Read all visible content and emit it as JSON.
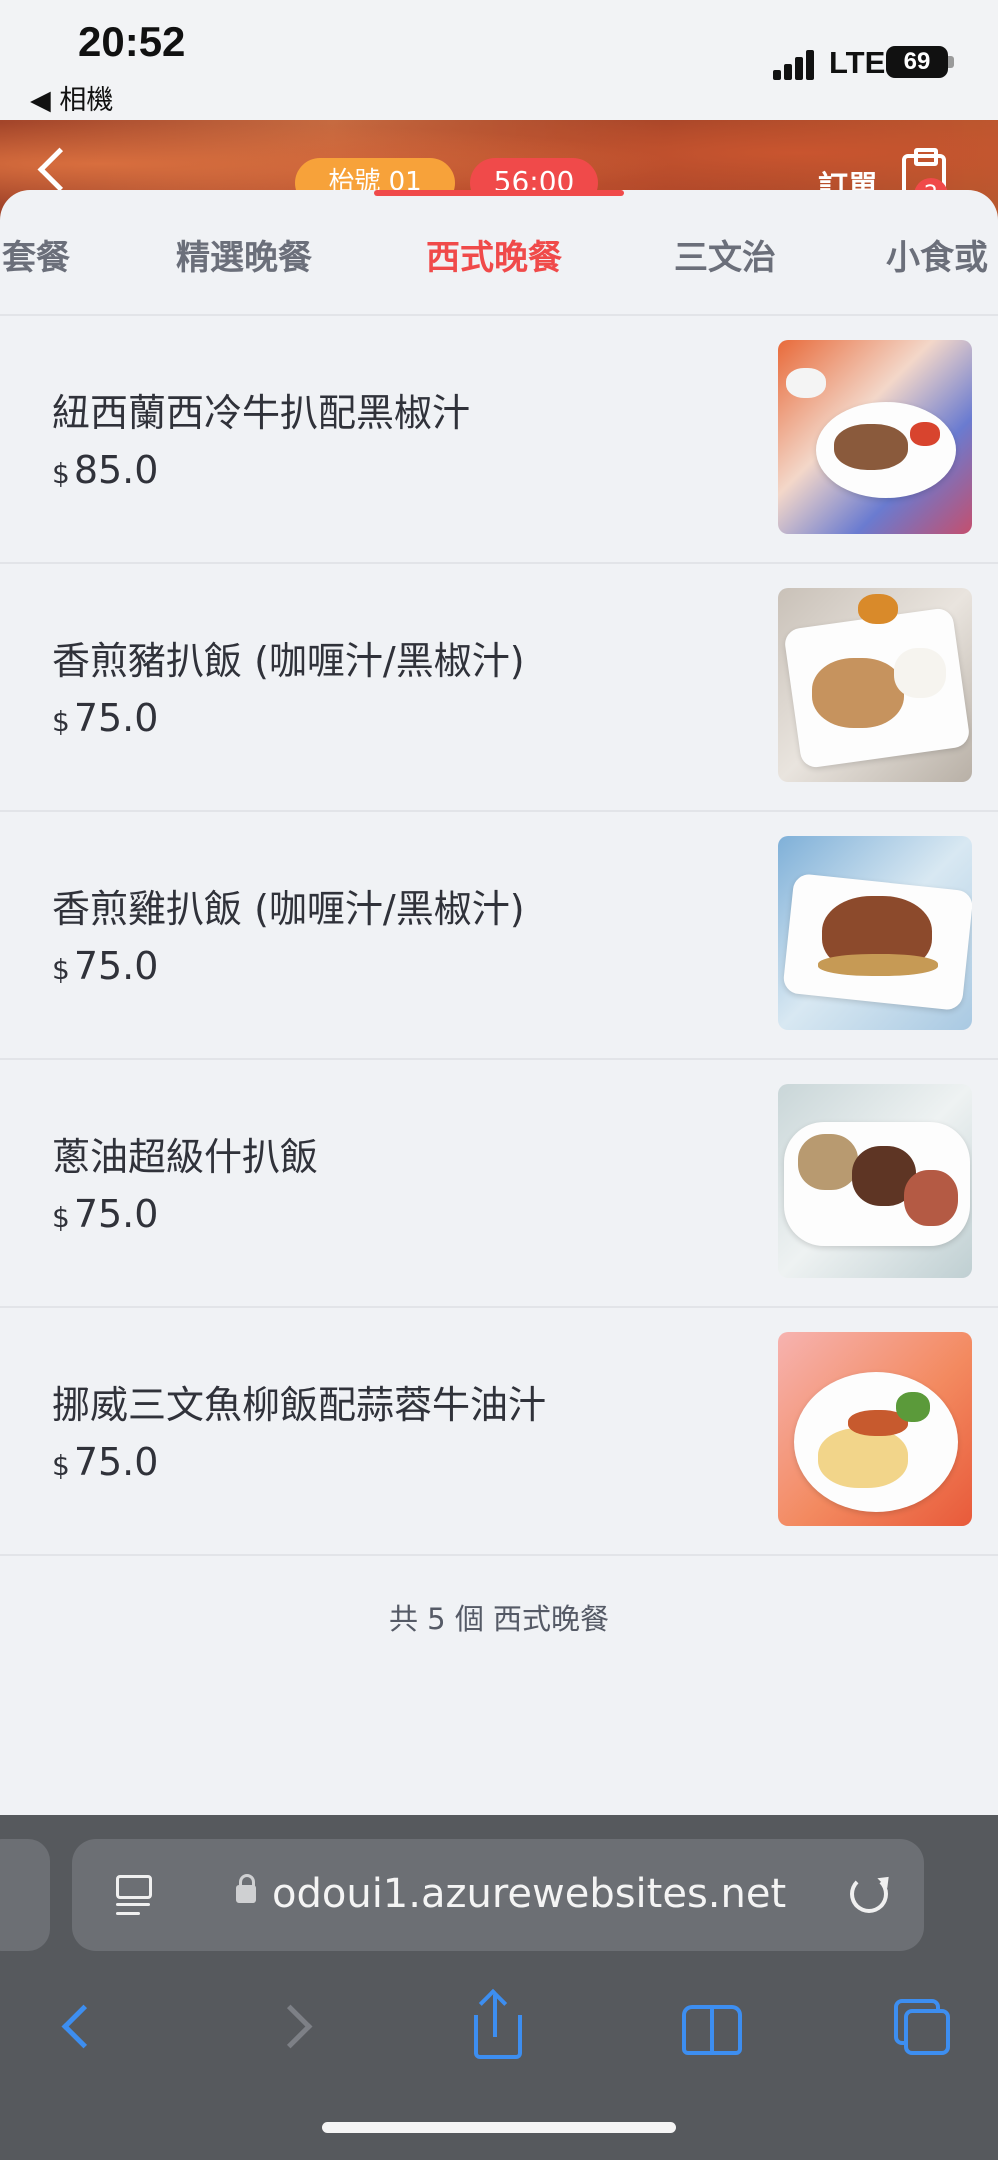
{
  "status": {
    "time": "20:52",
    "back_app": "◀ 相機",
    "network": "LTE",
    "battery": "69"
  },
  "header": {
    "table_label": "枱號 01",
    "timer": "56:00",
    "order_label": "訂單",
    "order_badge": "2"
  },
  "tabs": [
    {
      "label": "套餐"
    },
    {
      "label": "精選晚餐"
    },
    {
      "label": "西式晚餐",
      "active": true
    },
    {
      "label": "三文治"
    },
    {
      "label": "小食或"
    }
  ],
  "currency_symbol": "$",
  "items": [
    {
      "name": "紐西蘭西冷牛扒配黑椒汁",
      "price": "85.0"
    },
    {
      "name": "香煎豬扒飯 (咖喱汁/黑椒汁)",
      "price": "75.0"
    },
    {
      "name": "香煎雞扒飯 (咖喱汁/黑椒汁)",
      "price": "75.0"
    },
    {
      "name": "蔥油超級什扒飯",
      "price": "75.0"
    },
    {
      "name": "挪威三文魚柳飯配蒜蓉牛油汁",
      "price": "75.0"
    }
  ],
  "footer_note": "共 5 個 西式晚餐",
  "browser": {
    "url": "odoui1.azurewebsites.net"
  },
  "colors": {
    "accent": "#f04a4a",
    "table_pill": "#f7a23a",
    "browser_blue": "#3d8ef0"
  }
}
